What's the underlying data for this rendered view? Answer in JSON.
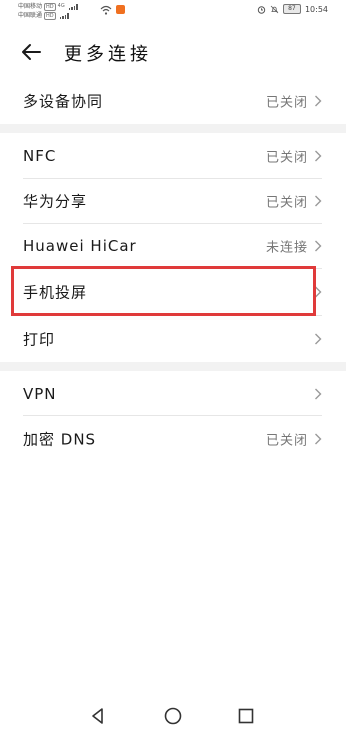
{
  "status_bar": {
    "carrier_1": "中国移动",
    "carrier_2": "中国联通",
    "hd_badge": "HD",
    "network_type": "4G",
    "time": "10:54",
    "battery": "87",
    "icons": [
      "wifi-icon",
      "app-notification-icon",
      "alarm-icon",
      "mute-icon",
      "battery-icon"
    ]
  },
  "header": {
    "title": "更多连接",
    "back_icon": "back-arrow-icon"
  },
  "sections": [
    {
      "items": [
        {
          "label": "多设备协同",
          "status": "已关闭"
        }
      ]
    },
    {
      "items": [
        {
          "label": "NFC",
          "status": "已关闭"
        },
        {
          "label": "华为分享",
          "status": "已关闭"
        },
        {
          "label": "Huawei HiCar",
          "status": "未连接"
        },
        {
          "label": "手机投屏",
          "status": ""
        },
        {
          "label": "打印",
          "status": ""
        }
      ]
    },
    {
      "items": [
        {
          "label": "VPN",
          "status": ""
        },
        {
          "label": "加密 DNS",
          "status": "已关闭"
        }
      ]
    }
  ],
  "highlight_color": "#e03a3a",
  "navigation_bar": {
    "icons": [
      "back-triangle-icon",
      "home-circle-icon",
      "recents-square-icon"
    ]
  }
}
